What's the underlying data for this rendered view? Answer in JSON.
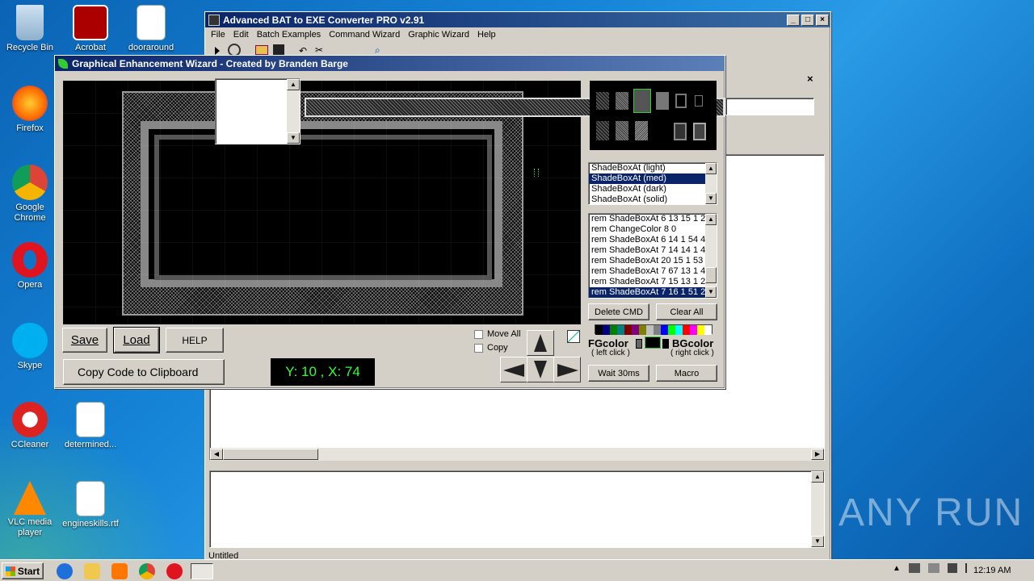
{
  "desktop": {
    "icons": [
      {
        "label": "Recycle Bin"
      },
      {
        "label": "Acrobat"
      },
      {
        "label": "dooraround"
      },
      {
        "label": "Firefox"
      },
      {
        "label": "Google Chrome"
      },
      {
        "label": "Opera"
      },
      {
        "label": "Skype"
      },
      {
        "label": "CCleaner"
      },
      {
        "label": "determined..."
      },
      {
        "label": "VLC media player"
      },
      {
        "label": "engineskills.rtf"
      }
    ],
    "watermark": "ANY RUN"
  },
  "main_window": {
    "title": "Advanced BAT to EXE Converter PRO v2.91",
    "menu": [
      "File",
      "Edit",
      "Batch Examples",
      "Command Wizard",
      "Graphic Wizard",
      "Help"
    ],
    "status": "Untitled"
  },
  "wizard": {
    "title": "Graphical Enhancement Wizard - Created by Branden Barge",
    "save_label": "Save",
    "load_label": "Load",
    "help_label": "HELP",
    "copy_label": "Copy Code to Clipboard",
    "coords": "Y: 10 , X: 74",
    "move_all_label": "Move All",
    "copy_check_label": "Copy",
    "style_list": [
      "ShadeBoxAt (light)",
      "ShadeBoxAt (med)",
      "ShadeBoxAt (dark)",
      "ShadeBoxAt (solid)"
    ],
    "style_selected": 1,
    "cmd_list": [
      "rem ShadeBoxAt 6 13 15 1 2",
      "rem ChangeColor 8 0",
      "rem ShadeBoxAt 6 14 1 54 4",
      "rem ShadeBoxAt 7 14 14 1 4",
      "rem ShadeBoxAt 20 15 1 53 4",
      "rem ShadeBoxAt 7 67 13 1 4",
      "rem ShadeBoxAt 7 15 13 1 2",
      "rem ShadeBoxAt 7 16 1 51 2"
    ],
    "cmd_selected": 7,
    "delete_label": "Delete CMD",
    "clear_label": "Clear All",
    "fg_label": "FGcolor",
    "fg_hint": "( left click )",
    "bg_label": "BGcolor",
    "bg_hint": "( right click )",
    "wait_label": "Wait 30ms",
    "macro_label": "Macro",
    "close_label": "x",
    "palette": [
      "#000000",
      "#000080",
      "#008000",
      "#008080",
      "#800000",
      "#800080",
      "#808000",
      "#c0c0c0",
      "#808080",
      "#0000ff",
      "#00ff00",
      "#00ffff",
      "#ff0000",
      "#ff00ff",
      "#ffff00",
      "#ffffff"
    ]
  },
  "taskbar": {
    "start_label": "Start",
    "clock": "12:19 AM"
  }
}
